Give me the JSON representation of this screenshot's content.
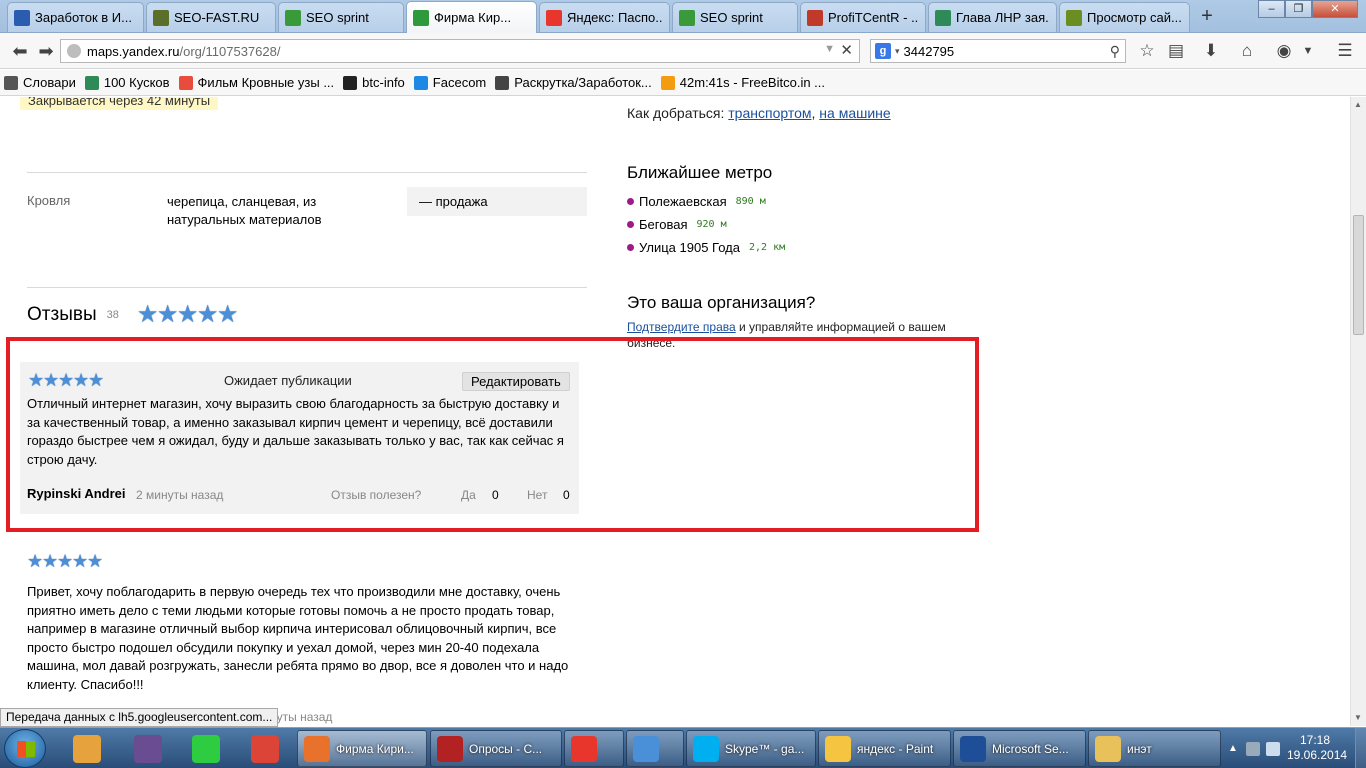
{
  "browser": {
    "tabs": [
      {
        "label": "Заработок в И...",
        "icon": "zona-icon",
        "color": "#2a5db0"
      },
      {
        "label": "SEO-FAST.RU",
        "icon": "sf-icon",
        "color": "#5a6f2a"
      },
      {
        "label": "SEO sprint",
        "icon": "seosprint-icon",
        "color": "#3a9a3a"
      },
      {
        "label": "Фирма Кир...",
        "icon": "loading-icon",
        "color": "#2e9a3c",
        "active": true
      },
      {
        "label": "Яндекс: Паспо...",
        "icon": "yandex-icon",
        "color": "#e8362d"
      },
      {
        "label": "SEO sprint",
        "icon": "seosprint-icon",
        "color": "#3a9a3a"
      },
      {
        "label": "ProfiTCentR - ...",
        "icon": "profit-icon",
        "color": "#c0392b"
      },
      {
        "label": "Глава ЛНР зая...",
        "icon": "news-icon",
        "color": "#2e8b57"
      },
      {
        "label": "Просмотр сай...",
        "icon": "tree-icon",
        "color": "#6b8e23"
      }
    ],
    "url_host": "maps.yandex.ru",
    "url_path": "/org/1107537628/",
    "search_value": "3442795",
    "bookmarks": [
      {
        "label": "Словари",
        "color": "#555555"
      },
      {
        "label": "100 Кусков",
        "color": "#2e8b57"
      },
      {
        "label": "Фильм Кровные узы ...",
        "color": "#e74c3c"
      },
      {
        "label": "btc-info",
        "color": "#222222"
      },
      {
        "label": "Facecom",
        "color": "#1e88e5"
      },
      {
        "label": "Раскрутка/Заработок...",
        "color": "#444444"
      },
      {
        "label": "42m:41s - FreeBitco.in ...",
        "color": "#f39c12"
      }
    ]
  },
  "page": {
    "closes_badge": "Закрывается через 42 минуты",
    "attribute": {
      "name": "Кровля",
      "value": "черепица, сланцевая, из натуральных материалов",
      "tag": "— продажа"
    },
    "reviews_title": "Отзывы",
    "reviews_count": "38",
    "my_review": {
      "status": "Ожидает публикации",
      "edit_label": "Редактировать",
      "text": "Отличный интернет магазин, хочу выразить свою благодарность за быструю доставку и за качественный товар, а именно заказывал кирпич цемент и черепицу, всё доставили гораздо быстрее чем я ожидал, буду и дальше заказывать только у вас, так как сейчас я строю дачу.",
      "author": "Rypinski Andrei",
      "time": "2 минуты назад",
      "useful_label": "Отзыв полезен?",
      "yes_label": "Да",
      "yes_count": "0",
      "no_label": "Нет",
      "no_count": "0",
      "rating": 5
    },
    "review2": {
      "text": "Привет, хочу поблагодарить в первую очередь тех что производили мне доставку, очень приятно иметь дело с теми людьми которые готовы помочь а не просто продать товар, например в магазине отличный выбор кирпича интерисовал облицовочный кирпич, все просто быстро подошел обсудили покупку и уехал домой, через мин 20-40 подехала машина, мол давай розгружать, занесли ребята прямо во двор, все я доволен что и надо клиенту. Спасибо!!!",
      "time_fragment": "нуты назад",
      "rating": 5
    },
    "sidebar": {
      "howto_label": "Как добраться:",
      "howto_transport": "транспортом",
      "howto_car": "на машине",
      "metro_title": "Ближайшее метро",
      "metro": [
        {
          "name": "Полежаевская",
          "distance": "890 м"
        },
        {
          "name": "Беговая",
          "distance": "920 м"
        },
        {
          "name": "Улица 1905 Года",
          "distance": "2,2 км"
        }
      ],
      "org_title": "Это ваша организация?",
      "org_link": "Подтвердите права",
      "org_text": " и управляйте информацией о вашем бизнесе."
    },
    "status_text": "Передача данных с lh5.googleusercontent.com..."
  },
  "taskbar": {
    "pinned": [
      {
        "name": "ball-icon",
        "color": "#e6a23c"
      },
      {
        "name": "game-avatar-icon",
        "color": "#6a4c93"
      },
      {
        "name": "green-a-icon",
        "color": "#2ecc40"
      },
      {
        "name": "chrome-icon",
        "color": "#db4437"
      }
    ],
    "buttons": [
      {
        "label": "Фирма Кири...",
        "color": "#e8712b",
        "active": true
      },
      {
        "label": "Опросы - С...",
        "color": "#b22222"
      },
      {
        "label": "",
        "color": "#e8362d"
      },
      {
        "label": "",
        "color": "#4a90d9"
      },
      {
        "label": "Skype™ - ga...",
        "color": "#00aff0"
      },
      {
        "label": "яндекс - Paint",
        "color": "#f5c542"
      },
      {
        "label": "Microsoft Se...",
        "color": "#1f4e99"
      },
      {
        "label": "инэт",
        "color": "#e8c15a"
      }
    ],
    "time": "17:18",
    "date": "19.06.2014"
  }
}
